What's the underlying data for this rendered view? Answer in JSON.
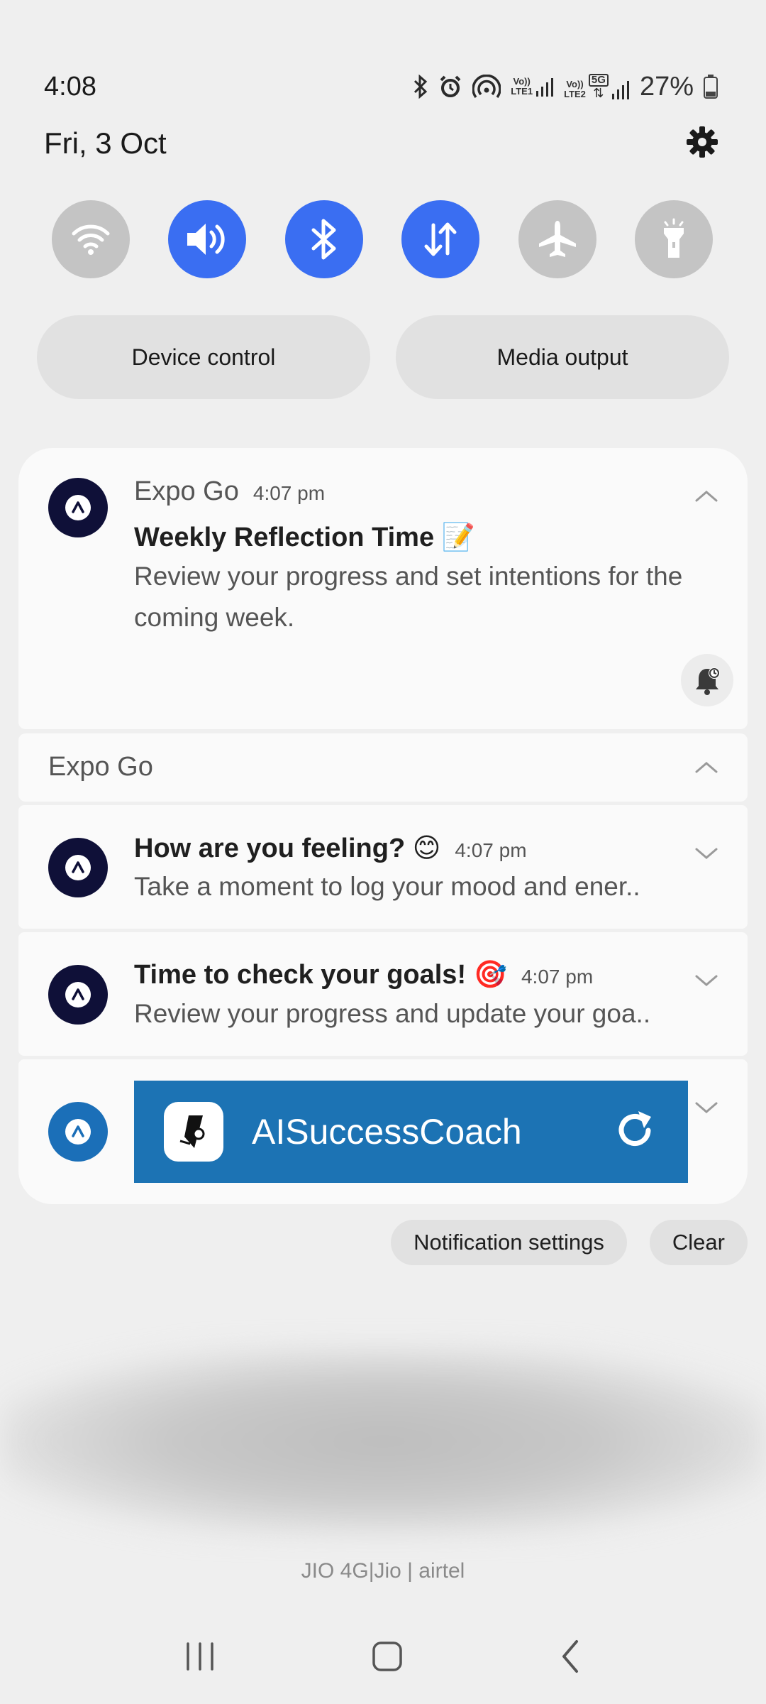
{
  "status_bar": {
    "time": "4:08",
    "sim1_label_top": "Vo))",
    "sim1_label_bottom": "LTE1",
    "sim2_label_top": "Vo))",
    "sim2_label_bottom": "LTE2",
    "network_type": "5G",
    "battery": "27%"
  },
  "date": "Fri, 3 Oct",
  "quick_settings": [
    {
      "icon": "wifi-icon",
      "state": "off"
    },
    {
      "icon": "sound-icon",
      "state": "on"
    },
    {
      "icon": "bluetooth-icon",
      "state": "on"
    },
    {
      "icon": "mobile-data-icon",
      "state": "on"
    },
    {
      "icon": "airplane-icon",
      "state": "off"
    },
    {
      "icon": "flashlight-icon",
      "state": "off"
    }
  ],
  "pills": {
    "device_control": "Device control",
    "media_output": "Media output"
  },
  "notifications": {
    "expanded": {
      "app": "Expo Go",
      "time": "4:07 pm",
      "title": "Weekly Reflection Time 📝",
      "body": "Review your progress and set intentions for the coming week."
    },
    "group_header": "Expo Go",
    "items": [
      {
        "title": "How are you feeling? 😊",
        "time": "4:07 pm",
        "body": "Take a moment to log your mood and ener.."
      },
      {
        "title": "Time to check your goals! 🎯",
        "time": "4:07 pm",
        "body": "Review your progress and update your goa.."
      }
    ],
    "banner_app": "AISuccessCoach"
  },
  "actions": {
    "settings": "Notification settings",
    "clear": "Clear"
  },
  "carrier": "JIO 4G|Jio | airtel",
  "colors": {
    "accent": "#3a6ef2",
    "app_icon": "#0f1038",
    "banner": "#1c73b4"
  }
}
